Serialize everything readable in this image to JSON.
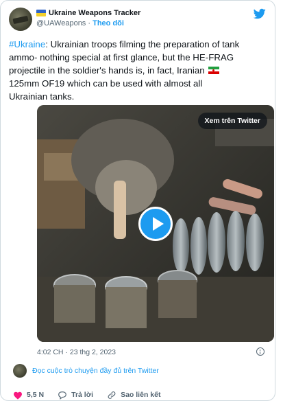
{
  "author": {
    "display_name": "Ukraine Weapons Tracker",
    "handle": "@UAWeapons",
    "separator": "·",
    "follow_label": "Theo dõi"
  },
  "tweet": {
    "hashtag": "#Ukraine",
    "text_part1": ": Ukrainian troops filming the preparation of tank ammo- nothing special at first glance, but the HE-FRAG projectile in the soldier's hands is, in fact, Iranian ",
    "text_part2": " 125mm OF19 which can be used with almost all Ukrainian tanks."
  },
  "media": {
    "watch_label": "Xem trên Twitter"
  },
  "timestamp": "4:02 CH · 23 thg 2, 2023",
  "thread_link": "Đọc cuộc trò chuyện đầy đủ trên Twitter",
  "actions": {
    "likes_count": "5,5 N",
    "reply_label": "Trả lời",
    "copy_link_label": "Sao liên kết"
  },
  "colors": {
    "accent": "#1d9bf0",
    "like": "#f91880",
    "muted": "#536471"
  }
}
